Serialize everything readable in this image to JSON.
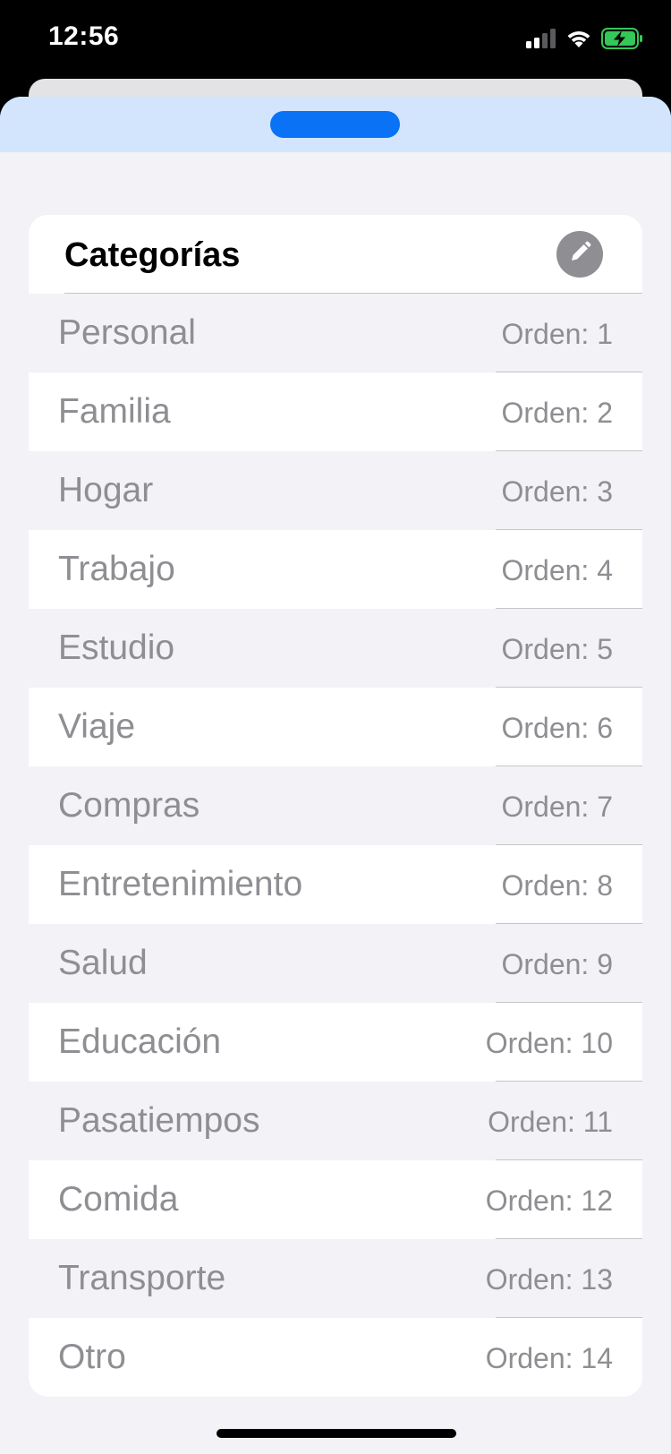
{
  "status_bar": {
    "time": "12:56",
    "icons": [
      "signal-icon",
      "wifi-icon",
      "battery-charging-icon"
    ],
    "battery_color": "#34c759"
  },
  "sheet": {
    "grabber_color": "#0a72f5",
    "header_color": "#d2e5fc"
  },
  "card": {
    "title": "Categorías",
    "edit_icon": "pencil-icon"
  },
  "categories": [
    {
      "name": "Personal",
      "order": "Orden: 1"
    },
    {
      "name": "Familia",
      "order": "Orden: 2"
    },
    {
      "name": "Hogar",
      "order": "Orden: 3"
    },
    {
      "name": "Trabajo",
      "order": "Orden: 4"
    },
    {
      "name": "Estudio",
      "order": "Orden: 5"
    },
    {
      "name": "Viaje",
      "order": "Orden: 6"
    },
    {
      "name": "Compras",
      "order": "Orden: 7"
    },
    {
      "name": "Entretenimiento",
      "order": "Orden: 8"
    },
    {
      "name": "Salud",
      "order": "Orden: 9"
    },
    {
      "name": "Educación",
      "order": "Orden: 10"
    },
    {
      "name": "Pasatiempos",
      "order": "Orden: 11"
    },
    {
      "name": "Comida",
      "order": "Orden: 12"
    },
    {
      "name": "Transporte",
      "order": "Orden: 13"
    },
    {
      "name": "Otro",
      "order": "Orden: 14"
    }
  ]
}
